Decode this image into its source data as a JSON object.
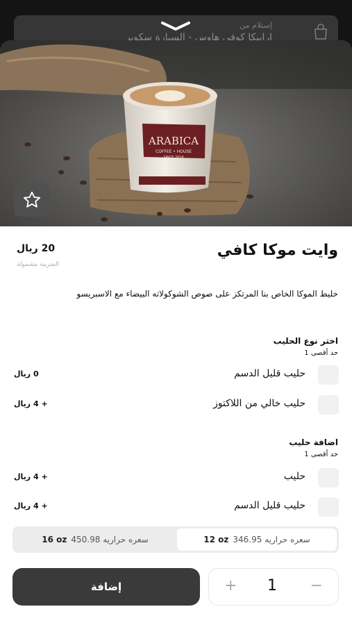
{
  "background": {
    "pickup_label": "إستلام من",
    "pickup_store": "ارابيكا كوفي هاوس - السيارة سكوير"
  },
  "product": {
    "name": "وايت موكا كافي",
    "price": "20 ريال",
    "tax_note": "الضريبة مشمولة",
    "description": "خليط الموكا الخاص بنا المرتكز على صوص الشوكولاته البيضاء مع الاسبريسو",
    "cup_brand": "ARABICA",
    "cup_sub": "COFFEE • HOUSE",
    "cup_since": "SINCE 2016"
  },
  "milk_type": {
    "title": "اختر نوع الحليب",
    "limit": "حد أقصى 1",
    "options": [
      {
        "label": "حليب قليل الدسم",
        "price": "0 ريال"
      },
      {
        "label": "حليب خالي من اللاكتوز",
        "price": "+ 4 ريال"
      }
    ]
  },
  "add_milk": {
    "title": "اضافة حليب",
    "limit": "حد أقصى 1",
    "options": [
      {
        "label": "حليب",
        "price": "+ 4 ريال"
      },
      {
        "label": "حليب قليل الدسم",
        "price": "+ 4 ريال"
      }
    ]
  },
  "sizes": [
    {
      "oz": "12 oz",
      "calories": "سعره حراريه 346.95",
      "selected": true
    },
    {
      "oz": "16 oz",
      "calories": "سعره حراريه 450.98",
      "selected": false
    }
  ],
  "cart": {
    "add_label": "إضافة",
    "quantity": "1",
    "plus": "+",
    "minus": "−"
  },
  "icons": {
    "favorite": "star-icon",
    "handle": "chevron-down-icon",
    "bag": "bag-icon"
  }
}
